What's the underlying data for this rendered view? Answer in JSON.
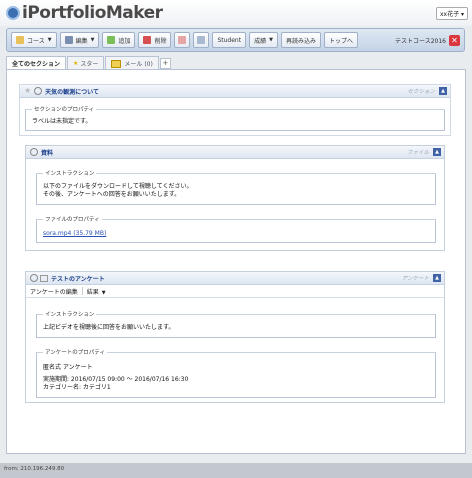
{
  "app": {
    "title": "iPortfolioMaker",
    "user_menu": "xx花子 ▾"
  },
  "toolbar": {
    "course": "コース",
    "edit": "編集",
    "add": "追加",
    "delete": "削除",
    "student": "Student",
    "grades": "成績",
    "reload": "再読み込み",
    "top": "トップへ",
    "course_name": "テストコース2016",
    "close": "✕"
  },
  "tabs": [
    {
      "label": "全てのセクション"
    },
    {
      "label": "スター"
    },
    {
      "label": "メール (0)"
    }
  ],
  "sections": [
    {
      "title": "天気の観測について",
      "type": "セクション",
      "props_legend": "セクションのプロパティ",
      "props_text": "ラベルは未指定です。"
    },
    {
      "title": "資料",
      "type": "ファイル",
      "instr_legend": "インストラクション",
      "instr_line1": "以下のファイルをダウンロードして視聴してください。",
      "instr_line2": "その後、アンケートへの回答をお願いいたします。",
      "file_legend": "ファイルのプロパティ",
      "file_link": "sora.mp4 (35.79 MB)"
    },
    {
      "title": "テストのアンケート",
      "type": "アンケート",
      "sub_edit": "アンケートの編集",
      "sub_results": "結果",
      "instr_legend": "インストラクション",
      "instr_text": "上記ビデオを視聴後に回答をお願いいたします。",
      "props_legend": "アンケートのプロパティ",
      "props_line1": "匿名式 アンケート",
      "props_line2": "実施期間: 2016/07/15 09:00 ～ 2016/07/16 16:30",
      "props_line3": "カテゴリー名: カテゴリ1"
    }
  ],
  "footer": {
    "ip": "from: 210.196.249.80"
  }
}
